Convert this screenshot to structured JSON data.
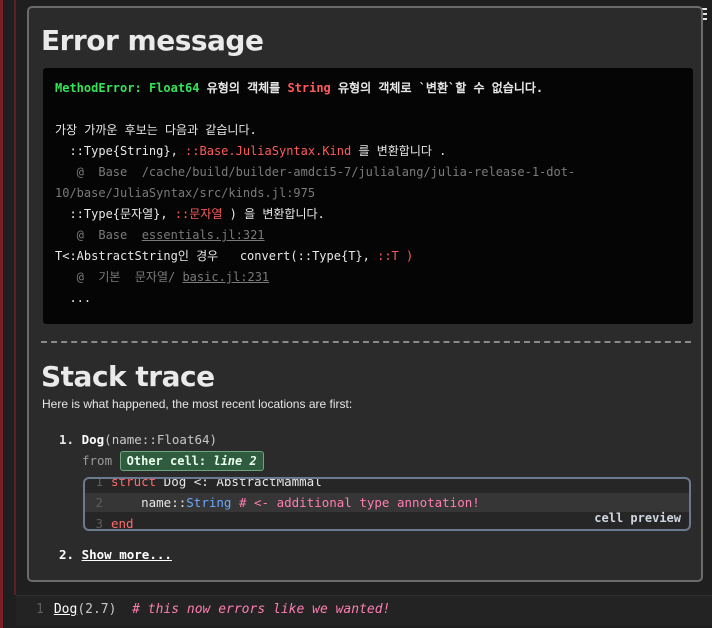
{
  "toc_icon": "list-icon",
  "error_section": {
    "title": "Error message",
    "message": {
      "error_type": "MethodError:",
      "error_type_name": "Float64",
      "error_text_1": " 유형의 객체를 ",
      "error_string": "String",
      "error_text_2": " 유형의 객체로 `변환`할 수 없습니다.",
      "candidates_heading": "가장 가까운 후보는 다음과 같습니다.",
      "cand1_prefix": "  ::Type{String}, ",
      "cand1_kind": "::Base.JuliaSyntax.Kind",
      "cand1_suffix": " 를 변환합니다 .",
      "cand1_loc_line1": "   @  Base  /cache/build/builder-amdci5-7/julialang/julia-release-1-dot-",
      "cand1_loc_line2": "10/base/JuliaSyntax/src/kinds.jl:975",
      "cand2_prefix": "  ::Type{문자열}, ",
      "cand2_arg": "::문자열",
      "cand2_suffix": " ) 을 변환합니다.",
      "cand2_loc_prefix": "   @  Base  ",
      "cand2_loc_file": "essentials.jl:321",
      "cand3_prefix": "T<:AbstractString인 경우   convert(::Type{T}, ",
      "cand3_arg": "::T )",
      "cand3_loc_prefix": "   @  기본  문자열/ ",
      "cand3_loc_file": "basic.jl:231",
      "ellipsis": "  ..."
    }
  },
  "stack_section": {
    "title": "Stack trace",
    "subtitle": "Here is what happened, the most recent locations are first:",
    "frames": [
      {
        "number": "1.",
        "function": "Dog",
        "args": "(name::Float64)",
        "from_label": "from",
        "cell_badge_label": "Other cell: ",
        "cell_badge_line": "line 2",
        "preview": {
          "line1_num": "1",
          "line1_kw": "struct",
          "line1_rest": " Dog <: AbstractMammal",
          "line2_num": "2",
          "line2_a": "    name::",
          "line2_type": "String",
          "line2_comment": " # <- additional type annotation!",
          "line3_num": "3",
          "line3_kw": "end",
          "label": "cell preview"
        }
      }
    ],
    "show_more_number": "2.",
    "show_more_label": "Show more..."
  },
  "input_cell": {
    "line_number": "1",
    "call": "Dog",
    "args": "(2.7)",
    "comment": "  # this now errors like we wanted!"
  }
}
